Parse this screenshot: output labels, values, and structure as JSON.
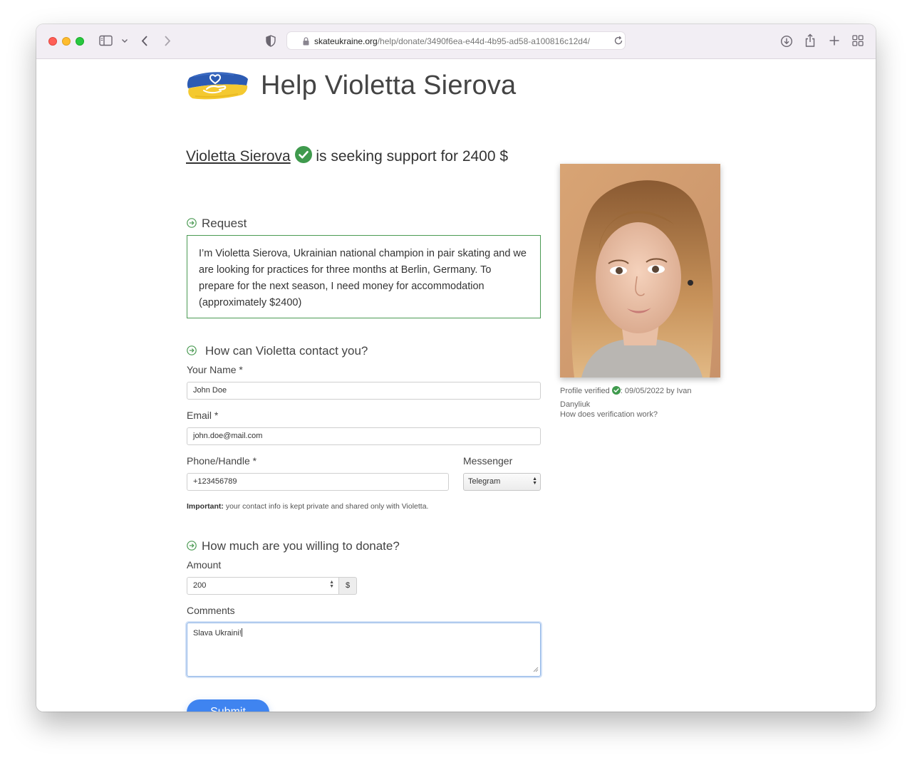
{
  "browser": {
    "url_host": "skateukraine.org",
    "url_path": "/help/donate/3490f6ea-e44d-4b95-ad58-a100816c12d4/"
  },
  "page": {
    "title": "Help Violetta Sierova",
    "headline_name": "Violetta Sierova",
    "headline_rest": " is seeking support for 2400 $"
  },
  "request": {
    "heading": "Request",
    "text": "I’m Violetta Sierova, Ukrainian national champion in pair skating and we are looking for practices for three months at Berlin, Germany. To prepare for the next season, I need money for accommodation (approximately $2400)"
  },
  "contact": {
    "heading": "How can Violetta contact you?",
    "name_label": "Your Name *",
    "name_value": "John Doe",
    "email_label": "Email *",
    "email_value": "john.doe@mail.com",
    "phone_label": "Phone/Handle *",
    "phone_value": "+123456789",
    "messenger_label": "Messenger",
    "messenger_value": "Telegram",
    "note_bold": "Important:",
    "note_text": " your contact info is kept private and shared only with Violetta."
  },
  "donate": {
    "heading": "How much are you willing to donate?",
    "amount_label": "Amount",
    "amount_value": "200",
    "currency": "$",
    "comments_label": "Comments",
    "comments_value": "Slava Ukraini!",
    "submit_label": "Submit"
  },
  "profile": {
    "verified_prefix": "Profile verified",
    "verified_suffix": ": 09/05/2022 by Ivan Danyliuk",
    "verification_help": "How does verification work?"
  },
  "colors": {
    "accent_green": "#4b9a53",
    "submit_blue": "#3f84f0"
  }
}
